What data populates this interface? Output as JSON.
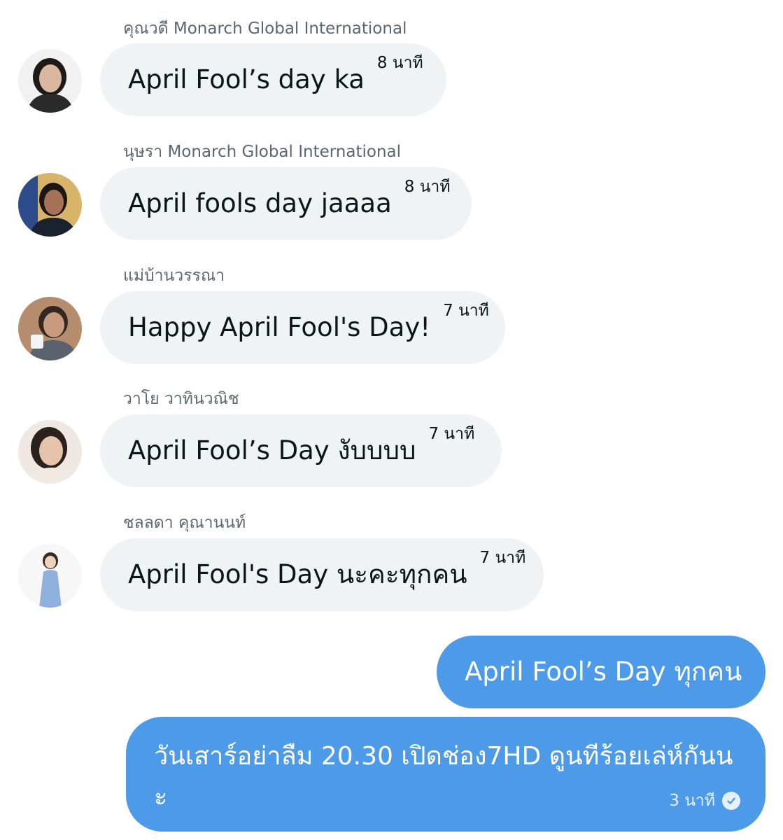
{
  "messages": [
    {
      "sender": "คุณวดี Monarch Global International",
      "text": "April Fool’s day ka",
      "time": "8 นาที",
      "avatar": "avatar-woman-dark-hair",
      "skin": "#d9b7a0",
      "hair": "#1d1a18",
      "cloth": "#2a2a2a",
      "bg": "#f1f1f1"
    },
    {
      "sender": "นุษรา Monarch Global International",
      "text": "April fools day jaaaa",
      "time": "8 นาที",
      "avatar": "avatar-woman-blue-bg",
      "skin": "#a77358",
      "hair": "#1b1714",
      "cloth": "#1a2230",
      "bg": "#2d4a8a"
    },
    {
      "sender": "แม่บ้านวรรณา",
      "text": "Happy April Fool's Day!",
      "time": "7 นาที",
      "avatar": "avatar-woman-with-mug",
      "skin": "#c99a7d",
      "hair": "#332820",
      "cloth": "#5a6270",
      "bg": "#b68d6c"
    },
    {
      "sender": "วาโย วาทินวณิช",
      "text": "April Fool’s Day งับบบบ",
      "time": "7 นาที",
      "avatar": "avatar-woman-smiling",
      "skin": "#e6c3ac",
      "hair": "#2b201b",
      "cloth": "#f2e9e2",
      "bg": "#efe7e1"
    },
    {
      "sender": "ชลลดา คุณานนท์",
      "text": "April Fool's Day นะคะทุกคน",
      "time": "7 นาที",
      "avatar": "avatar-woman-blue-dress",
      "skin": "#edd2c0",
      "hair": "#3a2a22",
      "cloth": "#8fb0dc",
      "bg": "#f7f7f7"
    }
  ],
  "outgoing": [
    {
      "text": "April Fool’s Day ทุกคน"
    },
    {
      "text": "วันเสาร์อย่าลืม 20.30 เปิดช่อง7HD ดูนทีร้อยเล่ห์กันนะ",
      "time": "3 นาที",
      "status_icon": "check-circle-icon"
    }
  ],
  "colors": {
    "incoming_bubble": "#eff3f4",
    "outgoing_bubble": "#4c9ae8",
    "sender_name": "#5c6670"
  }
}
